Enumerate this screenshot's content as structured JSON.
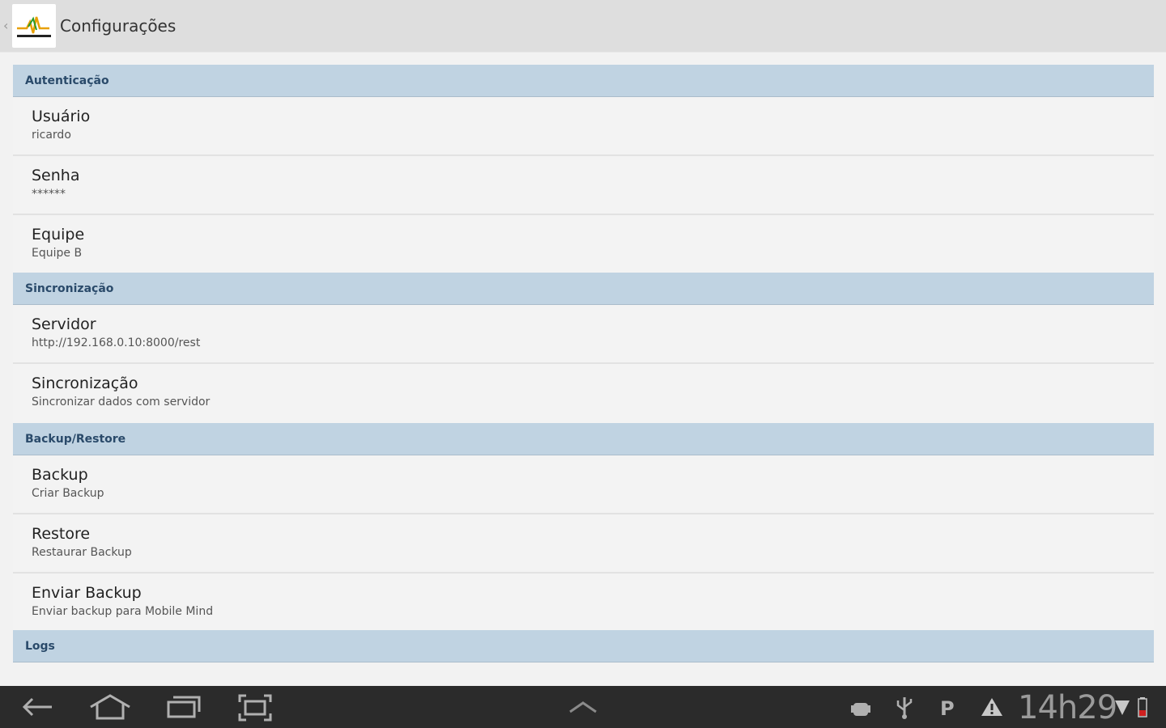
{
  "actionbar": {
    "title": "Configurações",
    "app_icon": "app-logo-icon"
  },
  "sections": [
    {
      "header": "Autenticação",
      "items": [
        {
          "title": "Usuário",
          "summary": "ricardo"
        },
        {
          "title": "Senha",
          "summary": "******"
        },
        {
          "title": "Equipe",
          "summary": "Equipe B"
        }
      ]
    },
    {
      "header": "Sincronização",
      "items": [
        {
          "title": "Servidor",
          "summary": "http://192.168.0.10:8000/rest"
        },
        {
          "title": "Sincronização",
          "summary": "Sincronizar dados com servidor"
        }
      ]
    },
    {
      "header": "Backup/Restore",
      "items": [
        {
          "title": "Backup",
          "summary": "Criar Backup"
        },
        {
          "title": "Restore",
          "summary": "Restaurar Backup"
        },
        {
          "title": "Enviar Backup",
          "summary": "Enviar backup para Mobile Mind"
        }
      ]
    },
    {
      "header": "Logs",
      "items": []
    }
  ],
  "navbar": {
    "buttons": [
      "back-icon",
      "home-icon",
      "recent-apps-icon",
      "screenshot-icon",
      "expand-up-icon"
    ]
  },
  "statusbar": {
    "time": "14h29",
    "icons": [
      "android-debug-icon",
      "usb-icon",
      "p-notification-icon",
      "warning-icon",
      "wifi-icon",
      "battery-icon"
    ]
  },
  "colors": {
    "category_bg": "#c0d3e2",
    "category_text": "#2a4a6a",
    "navbar_bg": "#2b2b2b",
    "actionbar_bg": "#dedede"
  }
}
